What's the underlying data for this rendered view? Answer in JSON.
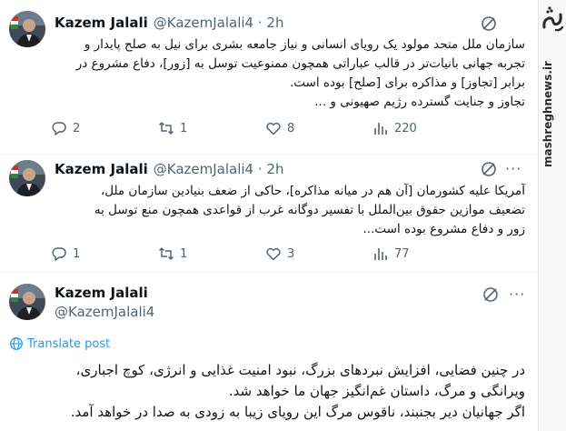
{
  "tweets": [
    {
      "author_name": "Kazem Jalali",
      "meta": "@KazemJalali4 · 2h",
      "lines": [
        "سازمان ملل متحد مولود یک رویای انسانی و نیاز جامعه بشری برای نیل به صلح پایدار و",
        "تجربه جهانی بانیات‌تر در قالب عباراتی همچون ممنوعیت توسل به [زور]، دفاع مشروع در",
        "برابر [تجاوز] و مذاکره برای [صلح] بوده است.",
        "تجاوز و جنایت گسترده رژیم صهیونی و ..."
      ],
      "replies": "2",
      "retweets": "1",
      "likes": "8",
      "views": "220"
    },
    {
      "author_name": "Kazem Jalali",
      "meta": "@KazemJalali4 · 2h",
      "lines": [
        "آمریکا علیه کشورمان [آن هم در میانه مذاکره]، حاکی از ضعف بنیادین سازمان ملل،",
        "تضعیف موازین حقوق بین‌الملل با تفسیر دوگانه غرب از قواعدی همچون منع توسل به",
        "زور و دفاع مشروع بوده است..."
      ],
      "replies": "1",
      "retweets": "1",
      "likes": "3",
      "views": "77"
    },
    {
      "author_name": "Kazem Jalali",
      "handle": "@KazemJalali4",
      "translate_label": "Translate post",
      "lines": [
        "در چنین فضایی، افزایش نبردهای بزرگ، نبود امنیت غذایی و انرژی، کوچ اجباری،",
        "ویرانگی و مرگ، داستان غم‌انگیز جهان ما خواهد شد.",
        "اگر جهانیان دیر بجنبند، ناقوس مرگ این رویای زیبا به زودی به صدا در خواهد آمد."
      ]
    }
  ],
  "more_glyph": "···",
  "sidebar": {
    "logo_text": "مشرق",
    "site_name": "mashreghnews.ir"
  },
  "colors": {
    "accent": "#1d9bf0",
    "muted": "#536471",
    "text": "#0f1419",
    "logo": "#2b2b2b"
  }
}
